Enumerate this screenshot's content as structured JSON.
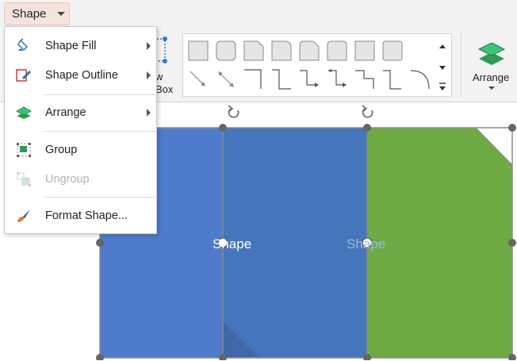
{
  "ribbon": {
    "tab": {
      "label": "Shape"
    },
    "textbox": {
      "label_line1": "w",
      "label_line2": "Box"
    },
    "arrange": {
      "label": "Arrange"
    }
  },
  "menu": {
    "items": [
      {
        "label": "Shape Fill",
        "icon": "paint-bucket-icon",
        "submenu": true,
        "enabled": true
      },
      {
        "label": "Shape Outline",
        "icon": "pen-outline-icon",
        "submenu": true,
        "enabled": true
      },
      {
        "label": "Arrange",
        "icon": "layers-icon",
        "submenu": true,
        "enabled": true
      },
      {
        "label": "Group",
        "icon": "group-icon",
        "submenu": false,
        "enabled": true
      },
      {
        "label": "Ungroup",
        "icon": "ungroup-icon",
        "submenu": false,
        "enabled": false
      },
      {
        "label": "Format Shape...",
        "icon": "brush-icon",
        "submenu": false,
        "enabled": true
      }
    ]
  },
  "canvas": {
    "shapes": [
      {
        "label": "Shape",
        "fill": "#4e7bcc"
      },
      {
        "label": "Shape",
        "fill": "#4575bb"
      },
      {
        "label": "",
        "fill": "#6fab45"
      }
    ]
  },
  "colors": {
    "blue_shape": "#4e7bcc",
    "blue_shape_dark": "#4575bb",
    "green_shape": "#6fab45",
    "menu_highlight": "#f6e3dd"
  }
}
